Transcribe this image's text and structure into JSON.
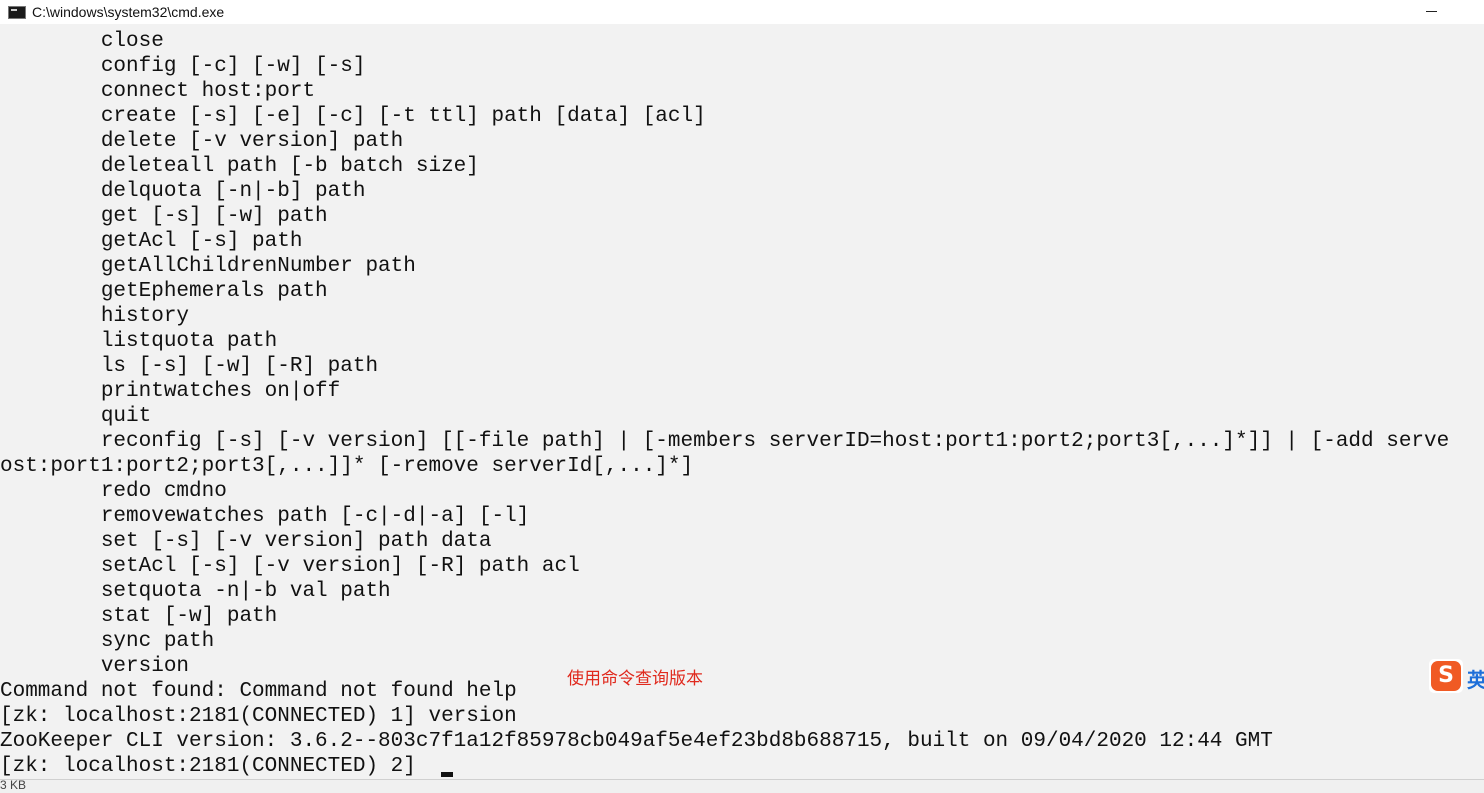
{
  "window": {
    "title": "C:\\windows\\system32\\cmd.exe",
    "app_icon": "cmd-icon",
    "minimize_icon": "minimize-icon"
  },
  "console": {
    "lines": [
      "        close",
      "        config [-c] [-w] [-s]",
      "        connect host:port",
      "        create [-s] [-e] [-c] [-t ttl] path [data] [acl]",
      "        delete [-v version] path",
      "        deleteall path [-b batch size]",
      "        delquota [-n|-b] path",
      "        get [-s] [-w] path",
      "        getAcl [-s] path",
      "        getAllChildrenNumber path",
      "        getEphemerals path",
      "        history",
      "        listquota path",
      "        ls [-s] [-w] [-R] path",
      "        printwatches on|off",
      "        quit",
      "        reconfig [-s] [-v version] [[-file path] | [-members serverID=host:port1:port2;port3[,...]*]] | [-add serve",
      "ost:port1:port2;port3[,...]]* [-remove serverId[,...]*]",
      "        redo cmdno",
      "        removewatches path [-c|-d|-a] [-l]",
      "        set [-s] [-v version] path data",
      "        setAcl [-s] [-v version] [-R] path acl",
      "        setquota -n|-b val path",
      "        stat [-w] path",
      "        sync path",
      "        version",
      "Command not found: Command not found help",
      "[zk: localhost:2181(CONNECTED) 1] version",
      "ZooKeeper CLI version: 3.6.2--803c7f1a12f85978cb049af5e4ef23bd8b688715, built on 09/04/2020 12:44 GMT",
      "[zk: localhost:2181(CONNECTED) 2] "
    ]
  },
  "annotation": {
    "text": "使用命令查询版本",
    "color": "#e0291d"
  },
  "ime": {
    "logo_text": "S",
    "label": "英",
    "logo_color": "#f05a24"
  },
  "statusbar": {
    "text": "3 KB"
  }
}
